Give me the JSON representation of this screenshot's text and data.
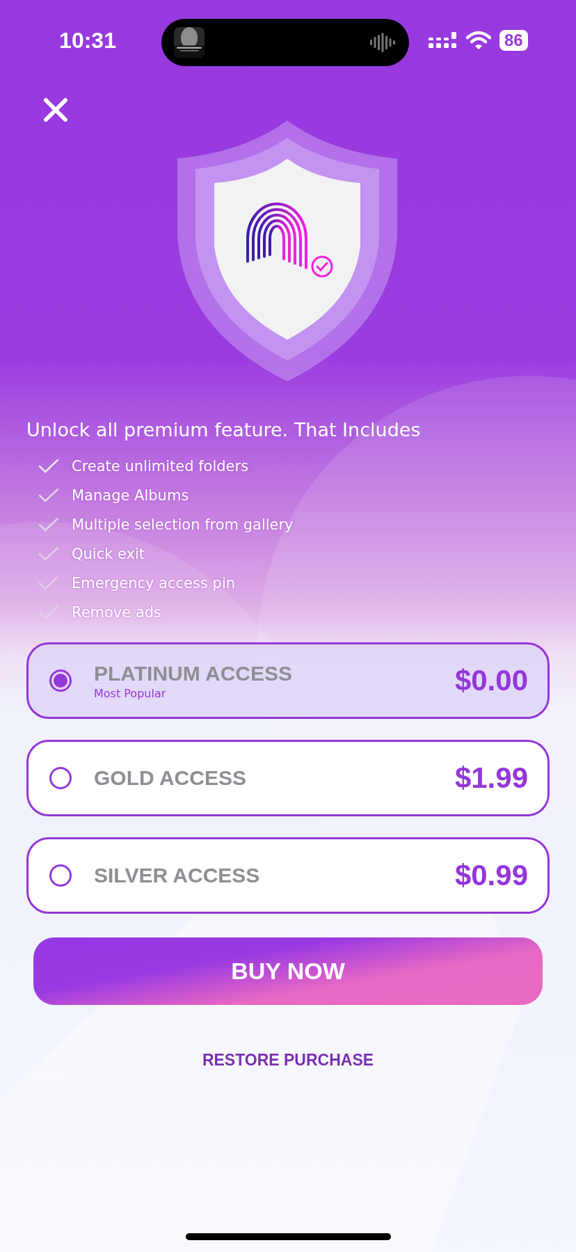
{
  "status_bar": {
    "time": "10:31",
    "battery": "86"
  },
  "heading": "Unlock all premium feature. That Includes",
  "features": [
    "Create unlimited folders",
    "Manage Albums",
    "Multiple selection from gallery",
    "Quick exit",
    "Emergency access pin",
    "Remove ads"
  ],
  "plans": [
    {
      "name": "PLATINUM ACCESS",
      "subtitle": "Most Popular",
      "price": "$0.00",
      "selected": true
    },
    {
      "name": "GOLD ACCESS",
      "price": "$1.99",
      "selected": false
    },
    {
      "name": "SILVER ACCESS",
      "price": "$0.99",
      "selected": false
    }
  ],
  "buy_button": "BUY NOW",
  "restore_link": "RESTORE PURCHASE"
}
